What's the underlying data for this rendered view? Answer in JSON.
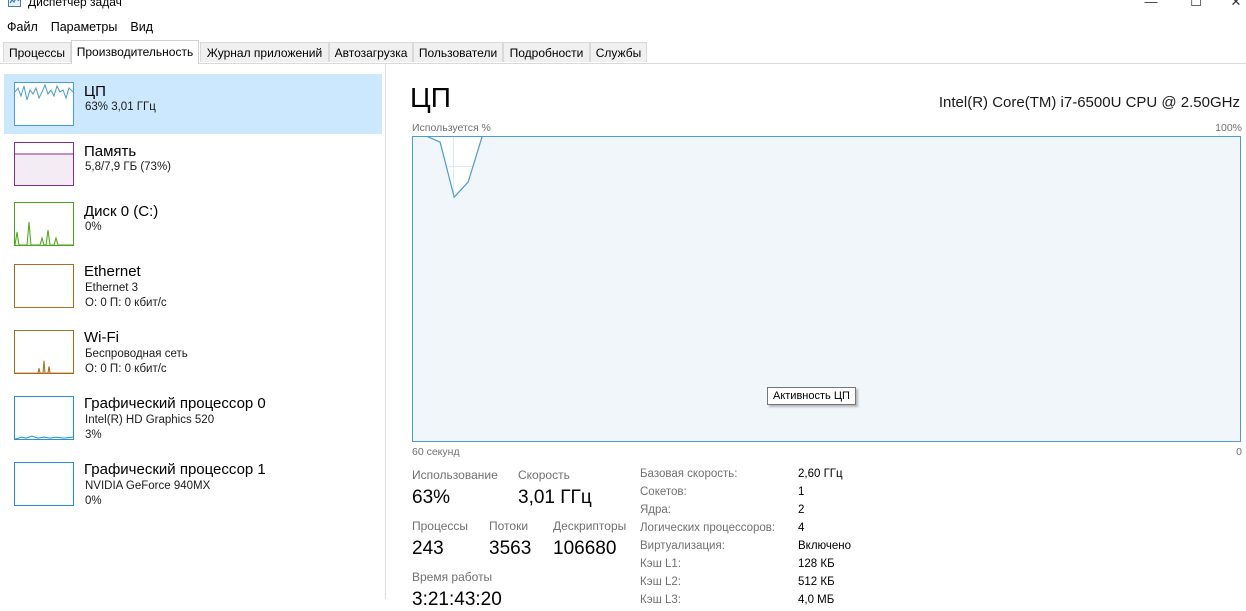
{
  "window": {
    "title": "Диспетчер задач"
  },
  "menu": [
    "Файл",
    "Параметры",
    "Вид"
  ],
  "tabs": [
    "Процессы",
    "Производительность",
    "Журнал приложений",
    "Автозагрузка",
    "Пользователи",
    "Подробности",
    "Службы"
  ],
  "active_tab": "Производительность",
  "resources": [
    {
      "name": "ЦП",
      "sub1": "63%  3,01 ГГц",
      "sub2": ""
    },
    {
      "name": "Память",
      "sub1": "5,8/7,9 ГБ (73%)",
      "sub2": ""
    },
    {
      "name": "Диск 0 (C:)",
      "sub1": "0%",
      "sub2": ""
    },
    {
      "name": "Ethernet",
      "sub1": "Ethernet 3",
      "sub2": "О: 0 П: 0 кбит/с"
    },
    {
      "name": "Wi-Fi",
      "sub1": "Беспроводная сеть",
      "sub2": "О: 0 П: 0 кбит/с"
    },
    {
      "name": "Графический процессор 0",
      "sub1": "Intel(R) HD Graphics 520",
      "sub2": "3%"
    },
    {
      "name": "Графический процессор 1",
      "sub1": "NVIDIA GeForce 940MX",
      "sub2": "0%"
    }
  ],
  "cpu": {
    "title": "ЦП",
    "model": "Intel(R) Core(TM) i7-6500U CPU @ 2.50GHz",
    "graph_label": "Используется %",
    "max_label": "100%",
    "time_label": "60 секунд",
    "min_label": "0",
    "tooltip": "Активность ЦП",
    "usage_series": [
      100,
      100,
      98,
      80,
      85,
      100,
      100,
      100,
      100,
      100,
      100,
      100,
      100,
      100,
      100,
      100,
      100,
      100,
      100,
      100,
      100,
      100,
      100,
      100,
      100,
      100,
      100,
      100,
      100,
      100,
      100,
      100,
      100,
      100,
      100,
      100,
      100,
      100,
      100,
      100,
      100,
      100,
      100,
      100,
      100,
      100,
      100,
      100,
      100,
      100,
      100,
      100,
      100,
      100,
      100,
      100,
      100,
      100,
      100,
      100
    ],
    "stats": {
      "usage_label": "Использование",
      "usage": "63%",
      "speed_label": "Скорость",
      "speed": "3,01 ГГц",
      "processes_label": "Процессы",
      "processes": "243",
      "threads_label": "Потоки",
      "threads": "3563",
      "handles_label": "Дескрипторы",
      "handles": "106680",
      "uptime_label": "Время работы",
      "uptime": "3:21:43:20"
    },
    "specs": [
      {
        "label": "Базовая скорость:",
        "value": "2,60 ГГц"
      },
      {
        "label": "Сокетов:",
        "value": "1"
      },
      {
        "label": "Ядра:",
        "value": "2"
      },
      {
        "label": "Логических процессоров:",
        "value": "4"
      },
      {
        "label": "Виртуализация:",
        "value": "Включено"
      },
      {
        "label": "Кэш L1:",
        "value": "128 КБ"
      },
      {
        "label": "Кэш L2:",
        "value": "512 КБ"
      },
      {
        "label": "Кэш L3:",
        "value": "4,0 МБ"
      }
    ]
  },
  "colors": {
    "cpu_line": "#4a9bd1",
    "cpu_fill": "#f1f6fb",
    "cpu_border": "#4a9bd1",
    "memory": "#8b2a8b",
    "disk": "#4da61b",
    "network": "#a7681b",
    "gpu": "#1f8fd1",
    "selected_bg": "#cce8ff"
  }
}
